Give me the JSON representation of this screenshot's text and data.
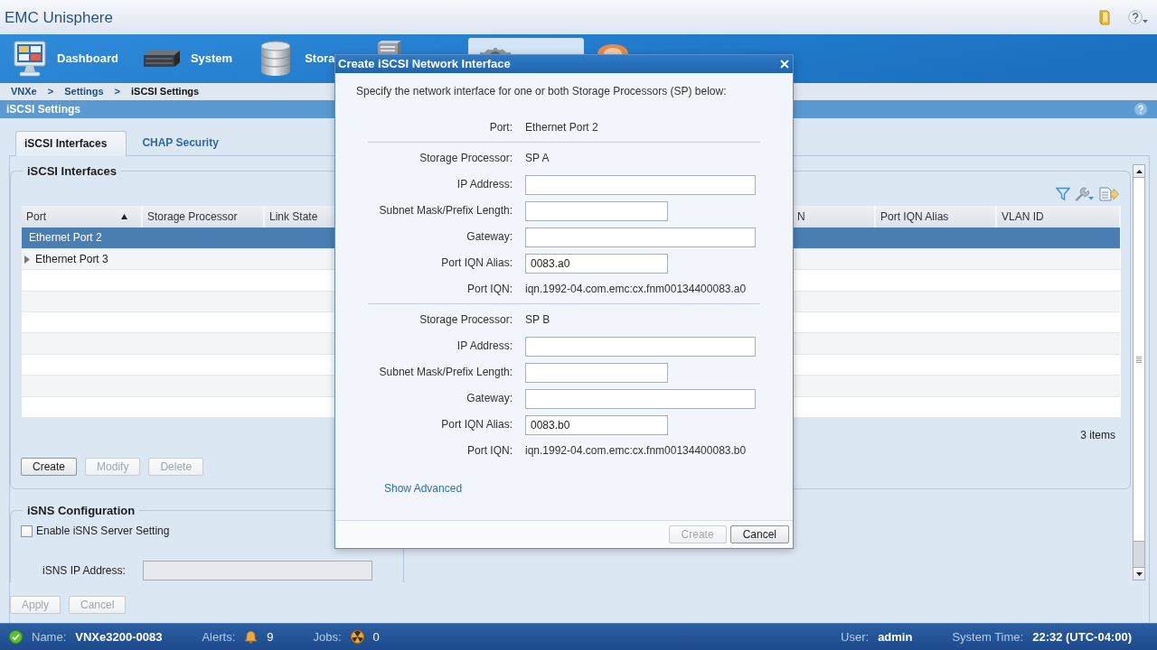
{
  "app": {
    "title": "EMC Unisphere"
  },
  "nav": [
    {
      "label": "Dashboard",
      "selected": false
    },
    {
      "label": "System",
      "selected": false
    },
    {
      "label": "Stora",
      "selected": false
    },
    {
      "selected": false
    },
    {
      "selected": true
    },
    {
      "selected": false
    }
  ],
  "breadcrumb": [
    {
      "kind": "link",
      "text": "VNXe"
    },
    {
      "kind": "separator",
      "text": ">"
    },
    {
      "kind": "link",
      "text": "Settings"
    },
    {
      "kind": "separator",
      "text": ">"
    },
    {
      "kind": "current",
      "text": "iSCSI Settings"
    }
  ],
  "page_title": "iSCSI Settings",
  "tabs": [
    {
      "label": "iSCSI Interfaces",
      "selected": true
    },
    {
      "label": "CHAP Security",
      "selected": false
    }
  ],
  "interfaces": {
    "legend": "iSCSI Interfaces",
    "table": {
      "columns": [
        {
          "label": "Port",
          "sorted": true
        },
        {
          "label": "Storage Processor",
          "sorted": false
        },
        {
          "label": "Link State",
          "sorted": false
        },
        {
          "label": "N",
          "sorted": false
        },
        {
          "label": "Port IQN Alias",
          "sorted": false
        },
        {
          "label": "VLAN ID",
          "sorted": false
        }
      ],
      "rows": [
        {
          "port": "Ethernet Port 2",
          "selected": true,
          "expandable": false
        },
        {
          "port": "Ethernet Port 3",
          "selected": false,
          "expandable": true
        }
      ]
    },
    "count": "3 items",
    "buttons": [
      {
        "label": "Create",
        "disabled": false
      },
      {
        "label": "Modify",
        "disabled": true
      },
      {
        "label": "Delete",
        "disabled": true
      }
    ]
  },
  "isns": {
    "legend": "iSNS Configuration",
    "enable": {
      "label": "Enable iSNS Server Setting",
      "checked": false
    },
    "ip": {
      "label": "iSNS IP Address:",
      "disabled": true
    }
  },
  "footer_buttons": [
    {
      "label": "Apply",
      "disabled": true
    },
    {
      "label": "Cancel",
      "disabled": true
    }
  ],
  "dialog": {
    "title": "Create iSCSI Network Interface",
    "intro": "Specify the network interface for one or both Storage Processors (SP) below:",
    "sections": [
      {
        "fields": [
          {
            "kind": "readout",
            "label": "Port:",
            "value": "Ethernet Port 2"
          }
        ]
      },
      {
        "fields": [
          {
            "kind": "readout",
            "label": "Storage Processor:",
            "value": "SP A"
          },
          {
            "kind": "wide",
            "label": "IP Address:"
          },
          {
            "kind": "narrow",
            "label": "Subnet Mask/Prefix Length:"
          },
          {
            "kind": "wide",
            "label": "Gateway:"
          },
          {
            "kind": "narrow",
            "label": "Port IQN Alias:",
            "value": "0083.a0"
          },
          {
            "kind": "readout",
            "label": "Port IQN:",
            "value": "iqn.1992-04.com.emc:cx.fnm00134400083.a0"
          }
        ]
      },
      {
        "fields": [
          {
            "kind": "readout",
            "label": "Storage Processor:",
            "value": "SP B"
          },
          {
            "kind": "wide",
            "label": "IP Address:"
          },
          {
            "kind": "narrow",
            "label": "Subnet Mask/Prefix Length:"
          },
          {
            "kind": "wide",
            "label": "Gateway:"
          },
          {
            "kind": "narrow",
            "label": "Port IQN Alias:",
            "value": "0083.b0"
          },
          {
            "kind": "readout",
            "label": "Port IQN:",
            "value": "iqn.1992-04.com.emc:cx.fnm00134400083.b0"
          }
        ]
      }
    ],
    "link": "Show Advanced",
    "buttons": [
      {
        "label": "Create",
        "disabled": true
      },
      {
        "label": "Cancel",
        "disabled": false
      }
    ]
  },
  "status_bar": [
    {
      "kind": "system",
      "label": "Name:",
      "value": "VNXe3200-0083"
    },
    {
      "kind": "alerts",
      "label": "Alerts:",
      "value": "9"
    },
    {
      "kind": "jobs",
      "label": "Jobs:",
      "value": "0"
    },
    {
      "kind": "user",
      "label": "User:",
      "value": "admin"
    },
    {
      "kind": "time",
      "label": "System Time:",
      "value": "22:32 (UTC-04:00)"
    }
  ]
}
